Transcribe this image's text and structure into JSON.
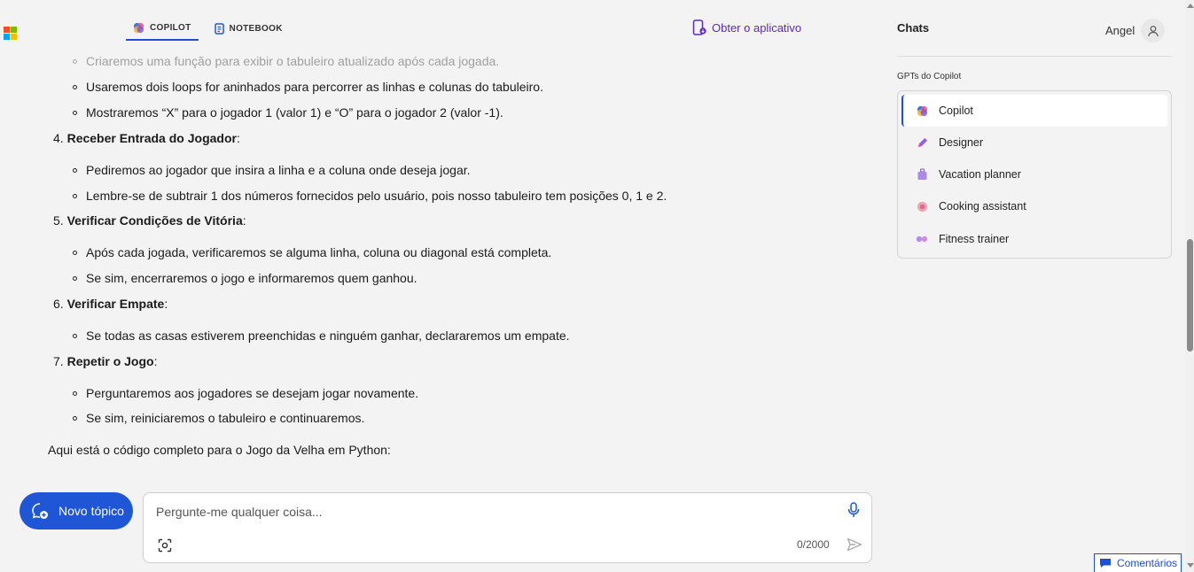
{
  "topnav": {
    "tabs": [
      {
        "label": "COPILOT",
        "active": true
      },
      {
        "label": "NOTEBOOK",
        "active": false
      }
    ],
    "get_app_label": "Obter o aplicativo"
  },
  "colors": {
    "accent": "#1f56d6",
    "get_app": "#5b2bbf",
    "ms_logo": [
      "#f25022",
      "#7fba00",
      "#00a4ef",
      "#ffb900"
    ]
  },
  "content": {
    "bullets_top": [
      "Criaremos uma função para exibir o tabuleiro atualizado após cada jogada.",
      "Usaremos dois loops for aninhados para percorrer as linhas e colunas do tabuleiro.",
      "Mostraremos “X” para o jogador 1 (valor 1) e “O” para o jogador 2 (valor -1)."
    ],
    "sections": [
      {
        "number": "4.",
        "title": "Receber Entrada do Jogador",
        "bullets": [
          "Pediremos ao jogador que insira a linha e a coluna onde deseja jogar.",
          "Lembre-se de subtrair 1 dos números fornecidos pelo usuário, pois nosso tabuleiro tem posições 0, 1 e 2."
        ]
      },
      {
        "number": "5.",
        "title": "Verificar Condições de Vitória",
        "bullets": [
          "Após cada jogada, verificaremos se alguma linha, coluna ou diagonal está completa.",
          "Se sim, encerraremos o jogo e informaremos quem ganhou."
        ]
      },
      {
        "number": "6.",
        "title": "Verificar Empate",
        "bullets": [
          "Se todas as casas estiverem preenchidas e ninguém ganhar, declararemos um empate."
        ]
      },
      {
        "number": "7.",
        "title": "Repetir o Jogo",
        "bullets": [
          "Perguntaremos aos jogadores se desejam jogar novamente.",
          "Se sim, reiniciaremos o tabuleiro e continuaremos."
        ]
      }
    ],
    "closing": "Aqui está o código completo para o Jogo da Velha em Python:"
  },
  "composer": {
    "new_topic_label": "Novo tópico",
    "placeholder": "Pergunte-me qualquer coisa...",
    "counter": "0/2000"
  },
  "sidebar": {
    "chats_title": "Chats",
    "user_name": "Angel",
    "gpts_title": "GPTs do Copilot",
    "items": [
      {
        "label": "Copilot",
        "icon": "copilot-icon",
        "active": true
      },
      {
        "label": "Designer",
        "icon": "designer-icon",
        "active": false
      },
      {
        "label": "Vacation planner",
        "icon": "suitcase-icon",
        "active": false
      },
      {
        "label": "Cooking assistant",
        "icon": "cooking-icon",
        "active": false
      },
      {
        "label": "Fitness trainer",
        "icon": "dumbbell-icon",
        "active": false
      }
    ]
  },
  "feedback_label": "Comentários"
}
